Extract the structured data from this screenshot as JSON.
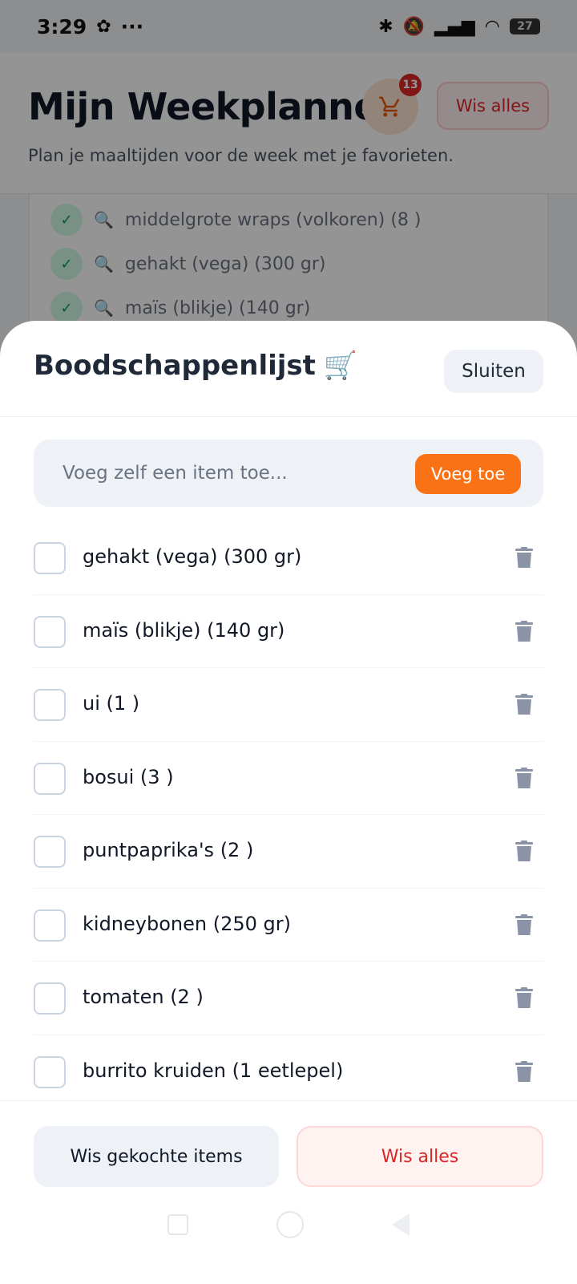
{
  "status_bar": {
    "time": "3:29",
    "dots": "···",
    "battery": "27"
  },
  "header": {
    "title": "Mijn Weekplanner",
    "subtitle": "Plan je maaltijden voor de week met je favorieten.",
    "cart_badge": "13",
    "clear_label": "Wis alles"
  },
  "background_ingredients": [
    "middelgrote wraps (volkoren) (8 )",
    "gehakt (vega) (300 gr)",
    "maïs (blikje) (140 gr)"
  ],
  "sheet": {
    "title": "Boodschappenlijst",
    "title_emoji": "🛒",
    "close_label": "Sluiten",
    "add_placeholder": "Voeg zelf een item toe...",
    "add_button": "Voeg toe",
    "items": [
      "gehakt (vega) (300 gr)",
      "maïs (blikje) (140 gr)",
      "ui (1 )",
      "bosui (3 )",
      "puntpaprika's (2 )",
      "kidneybonen (250 gr)",
      "tomaten (2 )",
      "burrito kruiden (1 eetlepel)"
    ],
    "clear_bought_label": "Wis gekochte items",
    "clear_all_label": "Wis alles"
  },
  "colors": {
    "accent": "#f97316",
    "danger": "#dc2626",
    "check_bg": "#d1fae5",
    "icon_gray": "#8a94a6"
  },
  "icons": {
    "cart": "shopping-cart-icon",
    "trash": "trash-icon",
    "check": "check-icon",
    "search": "magnifier-emoji-icon"
  }
}
